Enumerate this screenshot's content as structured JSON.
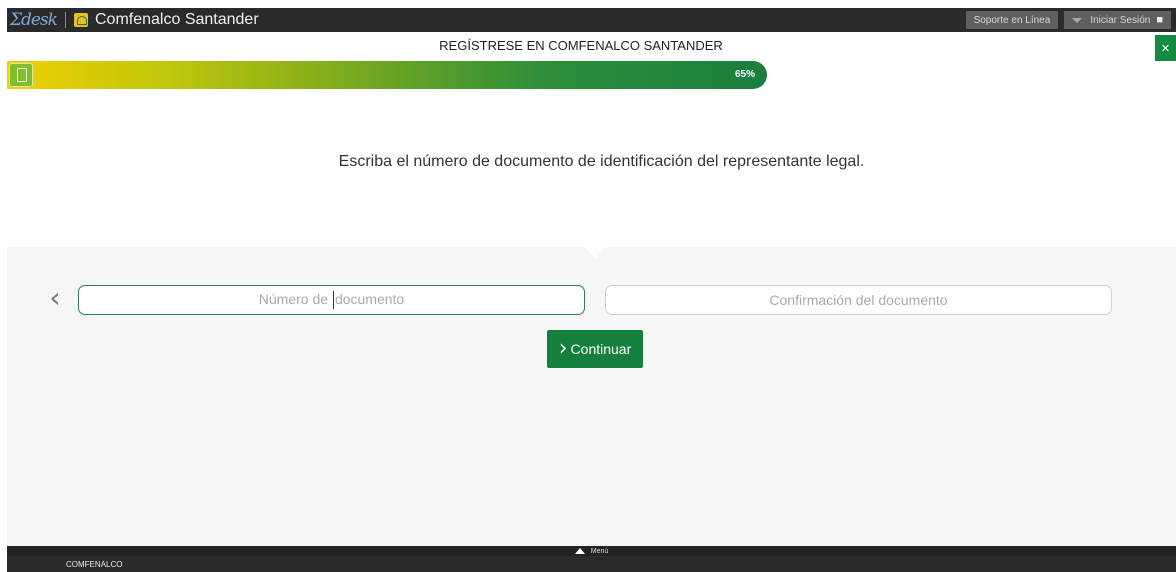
{
  "app": {
    "brand": "Σdesk",
    "title": "Comfenalco Santander"
  },
  "topbar": {
    "support_label": "Soporte en Línea",
    "login_label": "Iniciar Sesión"
  },
  "header": {
    "title": "REGÍSTRESE EN COMFENALCO SANTANDER",
    "close_glyph": "×"
  },
  "progress": {
    "value": 0.65,
    "label": "65%"
  },
  "instruction": "Escriba el número de documento de identificación del representante legal.",
  "form": {
    "document_placeholder": "Número de documento",
    "confirm_placeholder": "Confirmación del documento",
    "continue_label": "Continuar",
    "back_glyph": "‹"
  },
  "footer": {
    "menu_label": "Menú",
    "org_label": "COMFENALCO"
  },
  "colors": {
    "accent": "#15803d",
    "topbar": "#2a2a2a"
  },
  "icons": [
    "brand-logo",
    "organization-logo-icon",
    "user-icon",
    "dropdown-caret-icon",
    "close-icon",
    "document-icon",
    "chevron-left-icon",
    "chevron-right-icon",
    "triangle-up-icon"
  ]
}
